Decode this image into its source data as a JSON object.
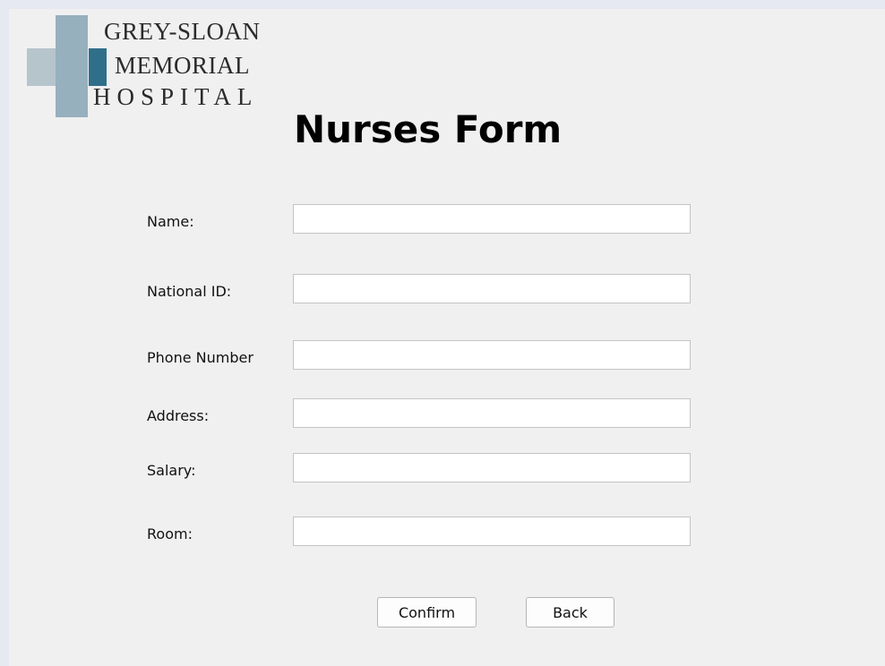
{
  "logo": {
    "line1": "GREY-SLOAN",
    "line2": "MEMORIAL",
    "line3": "HOSPITAL"
  },
  "form": {
    "title": "Nurses Form",
    "fields": [
      {
        "label": "Name:",
        "value": ""
      },
      {
        "label": "National ID:",
        "value": ""
      },
      {
        "label": "Phone Number",
        "value": ""
      },
      {
        "label": "Address:",
        "value": ""
      },
      {
        "label": "Salary:",
        "value": ""
      },
      {
        "label": "Room:",
        "value": ""
      }
    ]
  },
  "buttons": {
    "confirm": "Confirm",
    "back": "Back"
  },
  "colors": {
    "logo_blue": "#2f6f8a",
    "background": "#f0f0f0"
  }
}
